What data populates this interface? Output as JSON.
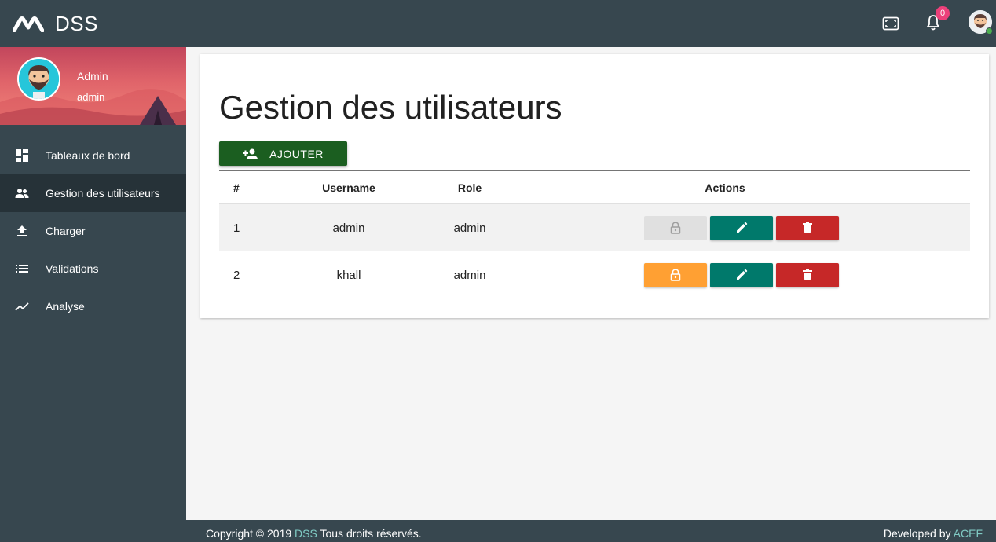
{
  "app": {
    "name": "DSS"
  },
  "topbar": {
    "notification_count": "0"
  },
  "sidebar": {
    "profile": {
      "name": "Admin",
      "role": "admin"
    },
    "items": [
      {
        "label": "Tableaux de bord",
        "icon": "dashboard-icon"
      },
      {
        "label": "Gestion des utilisateurs",
        "icon": "people-icon"
      },
      {
        "label": "Charger",
        "icon": "upload-icon"
      },
      {
        "label": "Validations",
        "icon": "list-icon"
      },
      {
        "label": "Analyse",
        "icon": "trending-icon"
      }
    ]
  },
  "main": {
    "title": "Gestion des utilisateurs",
    "add_label": "AJOUTER",
    "columns": [
      "#",
      "Username",
      "Role",
      "Actions"
    ],
    "rows": [
      {
        "num": "1",
        "username": "admin",
        "role": "admin",
        "lock_enabled": false
      },
      {
        "num": "2",
        "username": "khall",
        "role": "admin",
        "lock_enabled": true
      }
    ]
  },
  "footer": {
    "copyright_prefix": "Copyright © 2019",
    "brand_link": "DSS",
    "copyright_suffix": "Tous droits réservés.",
    "dev_prefix": "Developed by",
    "dev_link": "ACEF"
  },
  "colors": {
    "topbar": "#37474f",
    "add_button": "#1b5e20",
    "edit_button": "#00796b",
    "delete_button": "#c62828",
    "lock_button_active": "#ffa033",
    "badge": "#ec407a"
  }
}
